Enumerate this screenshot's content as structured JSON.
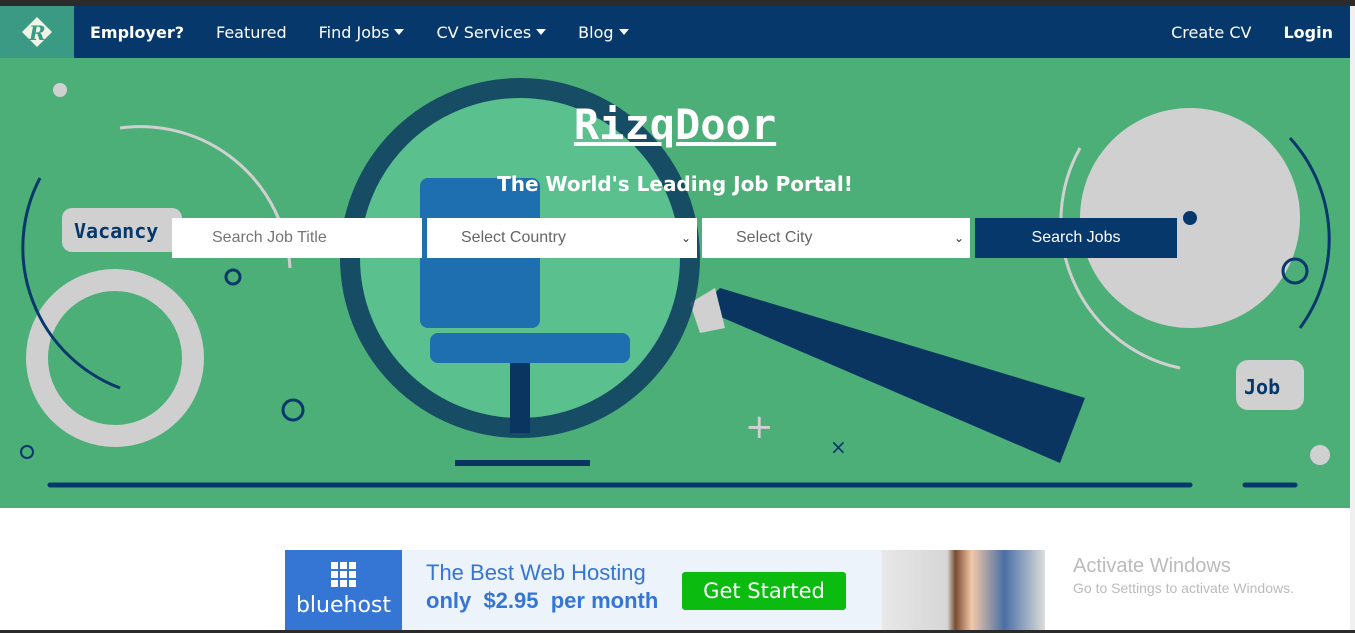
{
  "nav": {
    "items": [
      {
        "label": "Employer?"
      },
      {
        "label": "Featured"
      },
      {
        "label": "Find Jobs"
      },
      {
        "label": "CV Services"
      },
      {
        "label": "Blog"
      }
    ],
    "create_cv": "Create CV",
    "login": "Login"
  },
  "hero": {
    "title": "RizqDoor",
    "subtitle": "The World's Leading Job Portal!",
    "vacancy": "Vacancy",
    "job": "Job",
    "search": {
      "job_title_placeholder": "Search Job Title",
      "country": "Select Country",
      "city": "Select City",
      "button": "Search Jobs"
    }
  },
  "ad": {
    "brand": "bluehost",
    "line1": "The Best Web Hosting",
    "line2": "only  $2.95  per month",
    "cta": "Get Started"
  },
  "watermark": {
    "title": "Activate Windows",
    "subtitle": "Go to Settings to activate Windows."
  },
  "colors": {
    "nav": "#06386b",
    "hero": "#4daf78",
    "accent": "#3a9a84"
  }
}
